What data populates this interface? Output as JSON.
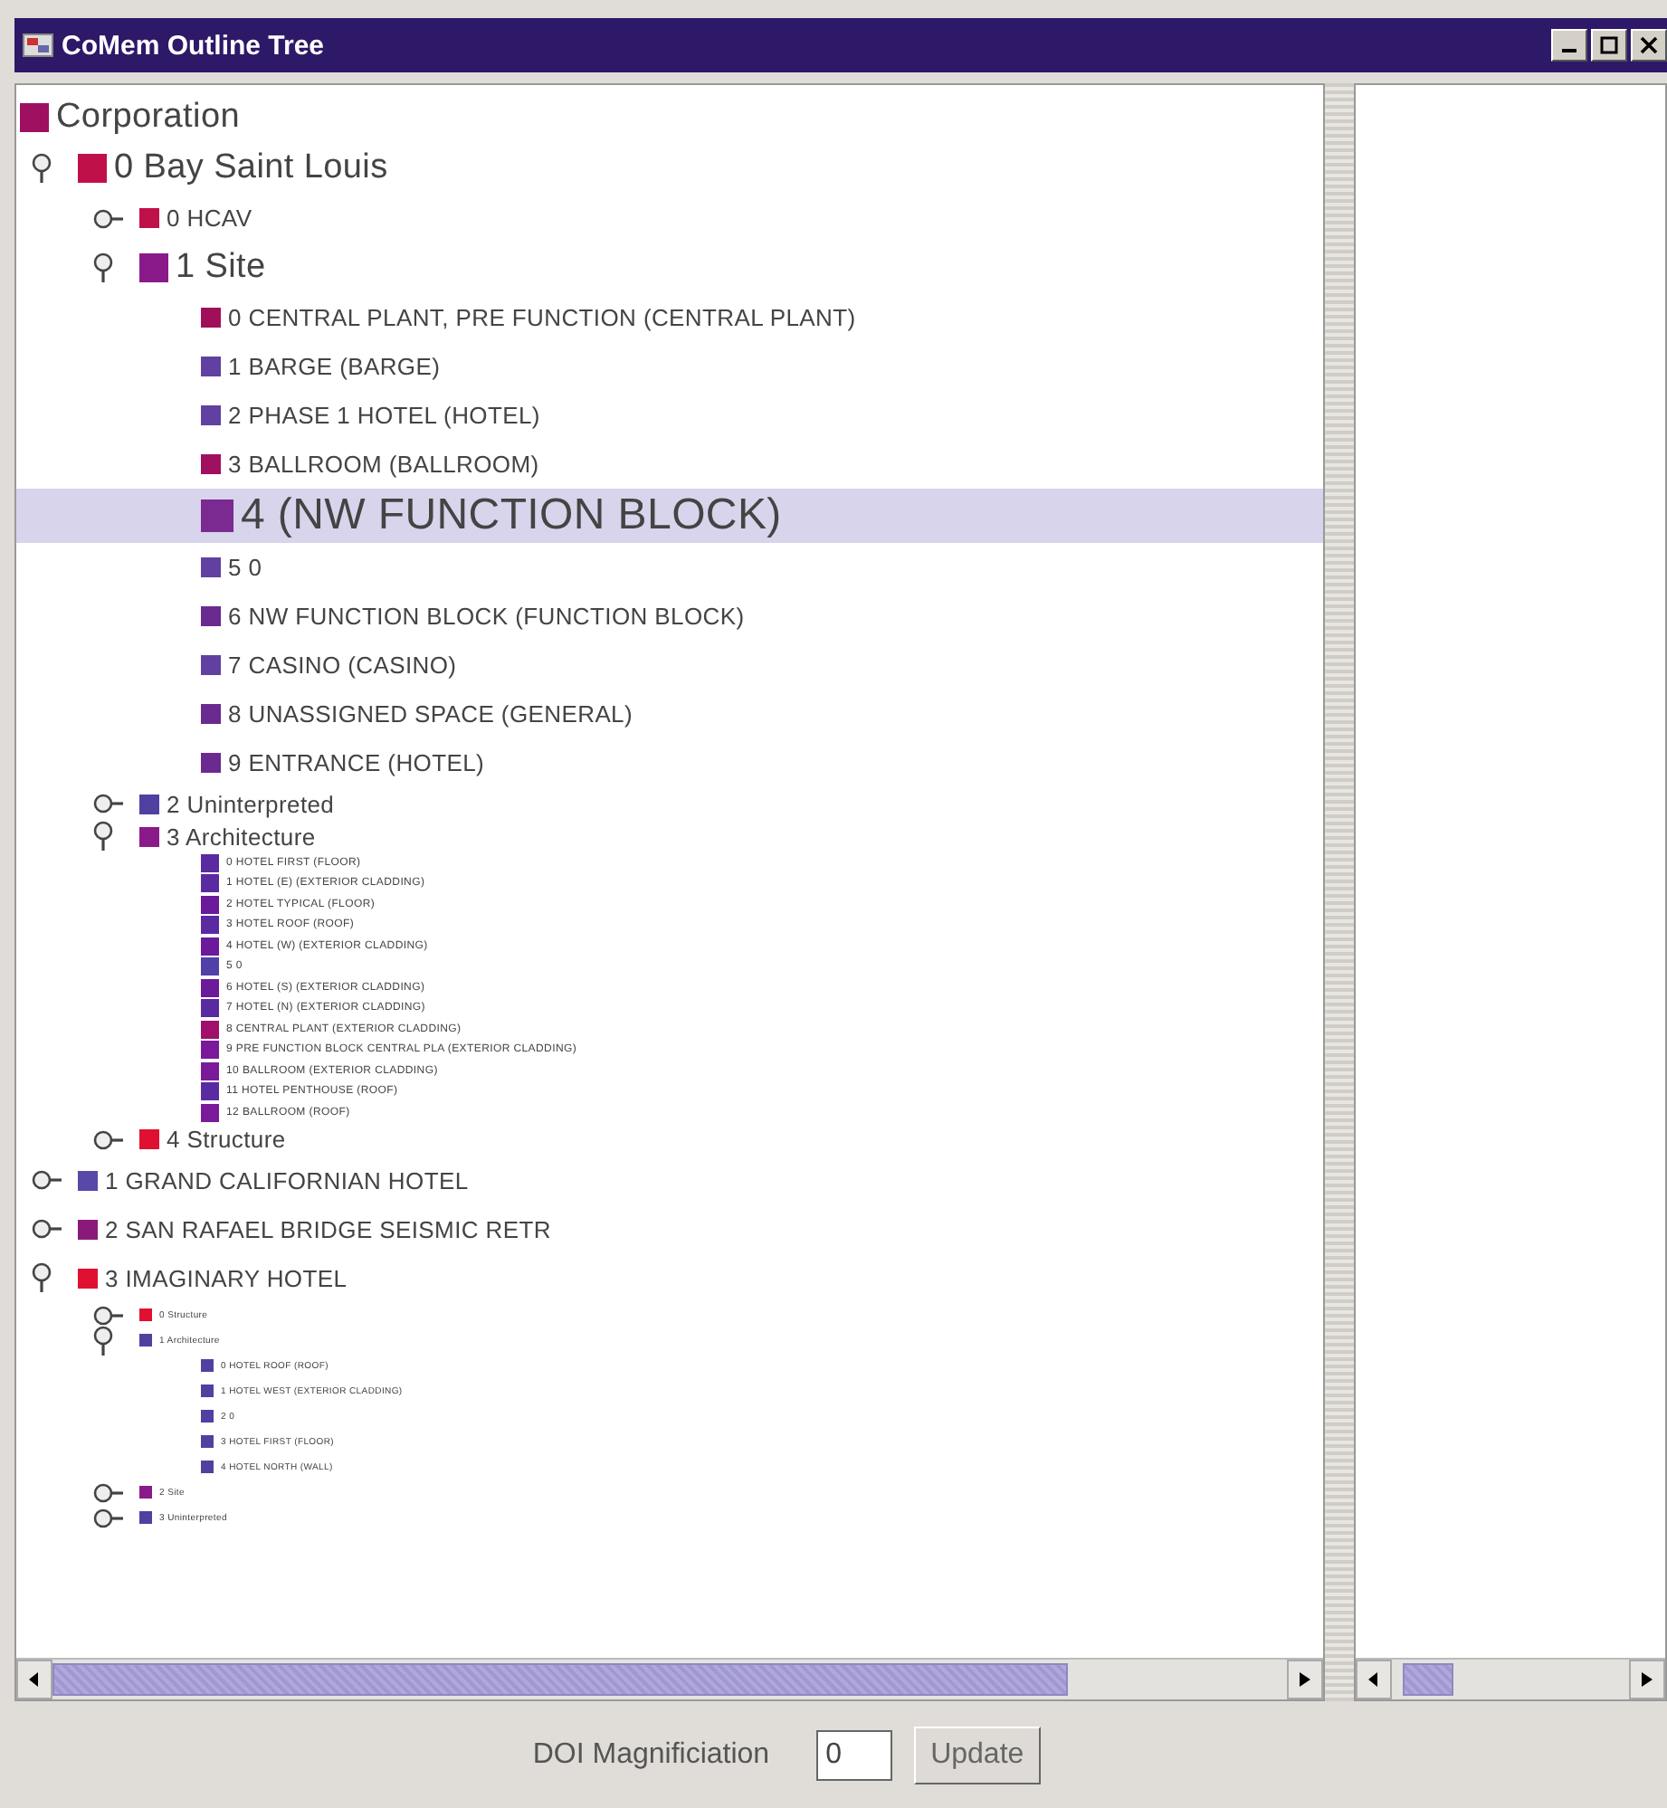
{
  "window": {
    "title": "CoMem Outline Tree"
  },
  "tree": {
    "label": "Corporation",
    "kind": "large",
    "color": "#a01060",
    "selected": false,
    "children": [
      {
        "label": "0 Bay Saint Louis",
        "kind": "large",
        "color": "#c0104a",
        "selected": false,
        "expanded": true,
        "children": [
          {
            "label": "0 HCAV",
            "kind": "medium",
            "color": "#c0104a",
            "selected": false,
            "expanded": false
          },
          {
            "label": "1 Site",
            "kind": "large",
            "color": "#8a1a8a",
            "selected": false,
            "expanded": true,
            "children": [
              {
                "label": "0 CENTRAL PLANT, PRE FUNCTION (CENTRAL PLANT)",
                "kind": "medium",
                "color": "#a0105a",
                "selected": false
              },
              {
                "label": "1 BARGE (BARGE)",
                "kind": "medium",
                "color": "#6040a0",
                "selected": false
              },
              {
                "label": "2 PHASE 1 HOTEL (HOTEL)",
                "kind": "medium",
                "color": "#6040a0",
                "selected": false
              },
              {
                "label": "3 BALLROOM (BALLROOM)",
                "kind": "medium",
                "color": "#a01060",
                "selected": false
              },
              {
                "label": "4  (NW FUNCTION BLOCK)",
                "kind": "huge",
                "color": "#7a2a90",
                "selected": true
              },
              {
                "label": "5 0",
                "kind": "medium",
                "color": "#6040a0",
                "selected": false
              },
              {
                "label": "6 NW FUNCTION BLOCK (FUNCTION BLOCK)",
                "kind": "medium",
                "color": "#6a2a90",
                "selected": false
              },
              {
                "label": "7 CASINO (CASINO)",
                "kind": "medium",
                "color": "#6040a0",
                "selected": false
              },
              {
                "label": "8 UNASSIGNED SPACE (GENERAL)",
                "kind": "medium",
                "color": "#6a2a90",
                "selected": false
              },
              {
                "label": "9 ENTRANCE (HOTEL)",
                "kind": "medium",
                "color": "#6a2a90",
                "selected": false
              }
            ]
          },
          {
            "label": "2 Uninterpreted",
            "kind": "small",
            "color": "#5040a0",
            "selected": false,
            "expanded": false
          },
          {
            "label": "3 Architecture",
            "kind": "small",
            "color": "#8a1a8a",
            "selected": false,
            "expanded": true,
            "children": [
              {
                "label": "0 HOTEL FIRST (FLOOR)",
                "kind": "tiny",
                "color": "#5a2aa0",
                "selected": false
              },
              {
                "label": "1 HOTEL (E) (EXTERIOR CLADDING)",
                "kind": "tiny",
                "color": "#5a2aa0",
                "selected": false
              },
              {
                "label": "2 HOTEL TYPICAL (FLOOR)",
                "kind": "tiny",
                "color": "#6a1a9a",
                "selected": false
              },
              {
                "label": "3 HOTEL ROOF (ROOF)",
                "kind": "tiny",
                "color": "#5a2aa0",
                "selected": false
              },
              {
                "label": "4 HOTEL (W) (EXTERIOR CLADDING)",
                "kind": "tiny",
                "color": "#6a1a9a",
                "selected": false
              },
              {
                "label": "5 0",
                "kind": "tiny",
                "color": "#5040a8",
                "selected": false
              },
              {
                "label": "6 HOTEL (S) (EXTERIOR CLADDING)",
                "kind": "tiny",
                "color": "#6a1a9a",
                "selected": false
              },
              {
                "label": "7 HOTEL (N) (EXTERIOR CLADDING)",
                "kind": "tiny",
                "color": "#5a2aa0",
                "selected": false
              },
              {
                "label": "8 CENTRAL PLANT (EXTERIOR CLADDING)",
                "kind": "tiny",
                "color": "#a0106a",
                "selected": false
              },
              {
                "label": "9 PRE FUNCTION BLOCK CENTRAL PLA (EXTERIOR CLADDING)",
                "kind": "tiny",
                "color": "#7a1a9a",
                "selected": false
              },
              {
                "label": "10 BALLROOM (EXTERIOR CLADDING)",
                "kind": "tiny",
                "color": "#7a1a9a",
                "selected": false
              },
              {
                "label": "11 HOTEL PENTHOUSE (ROOF)",
                "kind": "tiny",
                "color": "#5a2aa0",
                "selected": false
              },
              {
                "label": "12 BALLROOM (ROOF)",
                "kind": "tiny",
                "color": "#7a1a9a",
                "selected": false
              }
            ]
          },
          {
            "label": "4 Structure",
            "kind": "small",
            "color": "#e01030",
            "selected": false,
            "expanded": false
          }
        ]
      },
      {
        "label": "1 GRAND CALIFORNIAN HOTEL",
        "kind": "medium",
        "color": "#5848a8",
        "selected": false,
        "expanded": false
      },
      {
        "label": "2 SAN RAFAEL BRIDGE SEISMIC RETR",
        "kind": "medium",
        "color": "#8a1a7a",
        "selected": false,
        "expanded": false
      },
      {
        "label": "3 IMAGINARY HOTEL",
        "kind": "medium",
        "color": "#e01030",
        "selected": false,
        "expanded": true,
        "children": [
          {
            "label": "0 Structure",
            "kind": "micro",
            "color": "#e01030",
            "selected": false,
            "expanded": false
          },
          {
            "label": "1 Architecture",
            "kind": "micro",
            "color": "#5040a0",
            "selected": false,
            "expanded": true,
            "children": [
              {
                "label": "0 HOTEL ROOF (ROOF)",
                "kind": "micro",
                "color": "#5040a0",
                "selected": false
              },
              {
                "label": "1 HOTEL WEST (EXTERIOR CLADDING)",
                "kind": "micro",
                "color": "#5040a0",
                "selected": false
              },
              {
                "label": "2 0",
                "kind": "micro",
                "color": "#5040a0",
                "selected": false
              },
              {
                "label": "3 HOTEL FIRST (FLOOR)",
                "kind": "micro",
                "color": "#5040a0",
                "selected": false
              },
              {
                "label": "4 HOTEL NORTH (WALL)",
                "kind": "micro",
                "color": "#5040a0",
                "selected": false
              }
            ]
          },
          {
            "label": "2 Site",
            "kind": "micro",
            "color": "#8a1a8a",
            "selected": false,
            "expanded": false
          },
          {
            "label": "3 Uninterpreted",
            "kind": "micro",
            "color": "#5040a0",
            "selected": false,
            "expanded": false
          }
        ]
      }
    ]
  },
  "form": {
    "label": "DOI Magnificiation",
    "value": "0",
    "button": "Update"
  }
}
